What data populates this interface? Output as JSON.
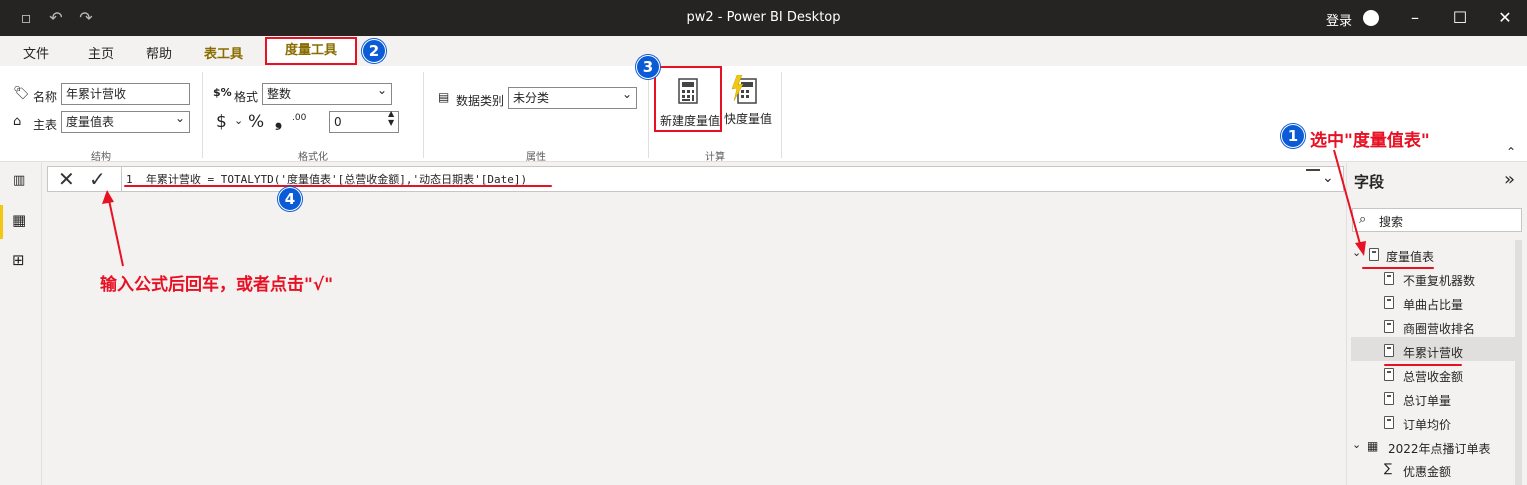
{
  "app": {
    "title": "pw2 - Power BI Desktop",
    "login": "登录"
  },
  "menu": {
    "file": "文件",
    "home": "主页",
    "help": "帮助",
    "table_tools": "表工具",
    "measure_tools": "度量工具"
  },
  "ribbon": {
    "name_label": "名称",
    "name_value": "年累计营收",
    "home_table_label": "主表",
    "home_table_value": "度量值表",
    "format_label": "格式",
    "format_value": "整数",
    "currency_symbol": "$",
    "percent_symbol": "%",
    "comma_symbol": "❟",
    "decimal_symbol": ".00",
    "decimal_places": "0",
    "data_category_label": "数据类别",
    "data_category_value": "未分类",
    "new_measure": "新建度量值",
    "quick_measure": "快度量值",
    "group_structure": "结构",
    "group_format": "格式化",
    "group_properties": "属性",
    "group_calc": "计算"
  },
  "formula": {
    "line_no": "1",
    "text": "年累计营收 = TOTALYTD('度量值表'[总营收金额],'动态日期表'[Date])"
  },
  "fields": {
    "title": "字段",
    "search_placeholder": "搜索",
    "table1": "度量值表",
    "measures": [
      "不重复机器数",
      "单曲占比量",
      "商圈营收排名",
      "年累计营收",
      "总营收金额",
      "总订单量",
      "订单均价"
    ],
    "table2": "2022年点播订单表",
    "table2_fields": [
      "优惠金额"
    ]
  },
  "annotations": {
    "badge1": "1",
    "badge2": "2",
    "badge3": "3",
    "badge4": "4",
    "note1": "选中\"度量值表\"",
    "note2": "输入公式后回车，或者点击\"√\""
  },
  "colors": {
    "accent_red": "#e81123",
    "badge_blue": "#0c5bd6",
    "titlebar": "#252423",
    "tab_gold": "#8a6d00"
  }
}
